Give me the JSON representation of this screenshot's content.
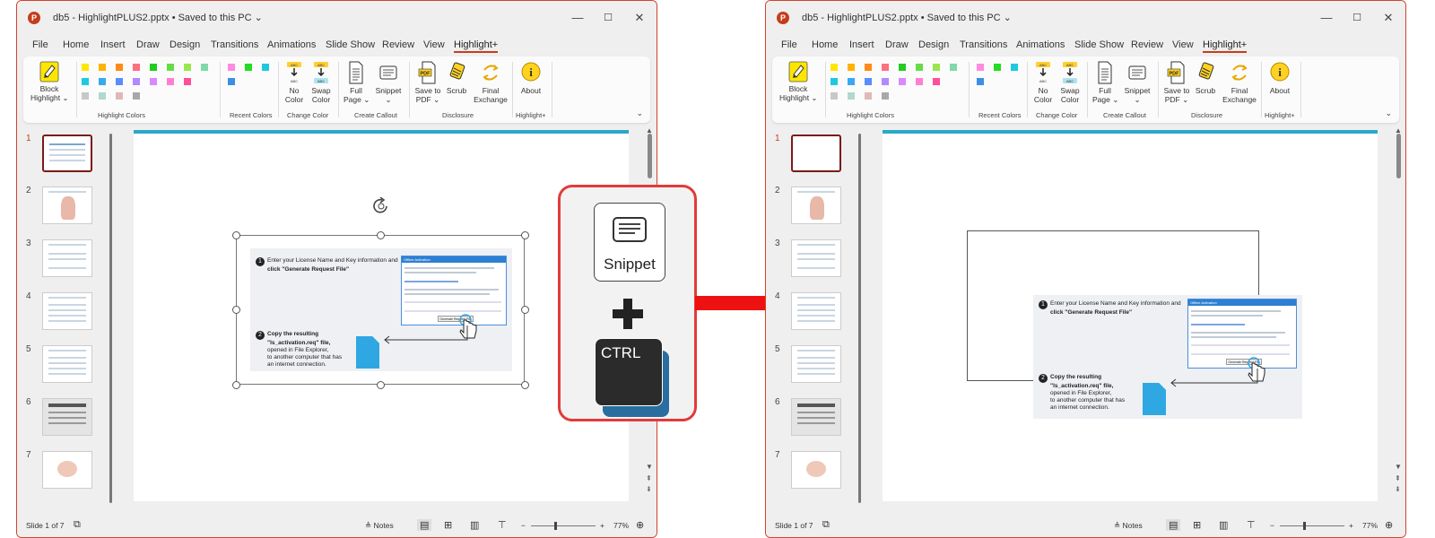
{
  "window": {
    "title": "db5 - HighlightPLUS2.pptx • Saved to this PC ⌄",
    "min": "—",
    "max": "☐",
    "close": "✕"
  },
  "menu": [
    "File",
    "Home",
    "Insert",
    "Draw",
    "Design",
    "Transitions",
    "Animations",
    "Slide Show",
    "Review",
    "View",
    "Highlight+"
  ],
  "ribbon": {
    "block_highlight": "Block\nHighlight ⌄",
    "no_color": "No\nColor",
    "swap_color": "Swap\nColor",
    "full_page": "Full\nPage ⌄",
    "snippet": "Snippet\n⌄",
    "save_pdf": "Save to\nPDF ⌄",
    "scrub": "Scrub",
    "final_exchange": "Final\nExchange",
    "about": "About",
    "groups": [
      "Highlight Colors",
      "Recent Colors",
      "Change Color",
      "Create Callout",
      "Disclosure",
      "Highlight+"
    ],
    "highlight_colors": [
      "#ffe600",
      "#ffb300",
      "#ff8a1a",
      "#ff6f7f",
      "#22cc22",
      "#66dd44",
      "#99e64d",
      "#7fd9a8",
      "#1ec9e0",
      "#3aa8f0",
      "#5a8cff",
      "#b08aff",
      "#d68aff",
      "#ff7fd0",
      "#ff4f9a",
      "",
      "#c8c8c8",
      "#b0d8d0",
      "#e0b8b8",
      "#a8a8a8"
    ],
    "recent_colors": [
      "#ff8ae0",
      "#22dd22",
      "#1ec9e0",
      "#3a8fe8"
    ],
    "accent": "#c43e1c"
  },
  "thumb_numbers": [
    "1",
    "2",
    "3",
    "4",
    "5",
    "6",
    "7"
  ],
  "status": {
    "slide": "Slide 1 of 7",
    "notes": "Notes",
    "zoom_minus": "−",
    "zoom_plus": "+",
    "zoom": "77%"
  },
  "picture": {
    "step1": "Enter your License Name and Key information and",
    "step1b": "click \"Generate Request File\"",
    "step2a": "Copy the resulting",
    "step2b": "\"ls_activation.req\" file,",
    "step2c": "opened in File Explorer,",
    "step2d": "to another computer that has",
    "step2e": "an internet connection.",
    "dialog_title": "Offline Activation",
    "dialog_btn": "Generate Request File"
  },
  "callout": {
    "snippet": "Snippet",
    "ctrl": "CTRL",
    "border": "#e33a3a"
  }
}
